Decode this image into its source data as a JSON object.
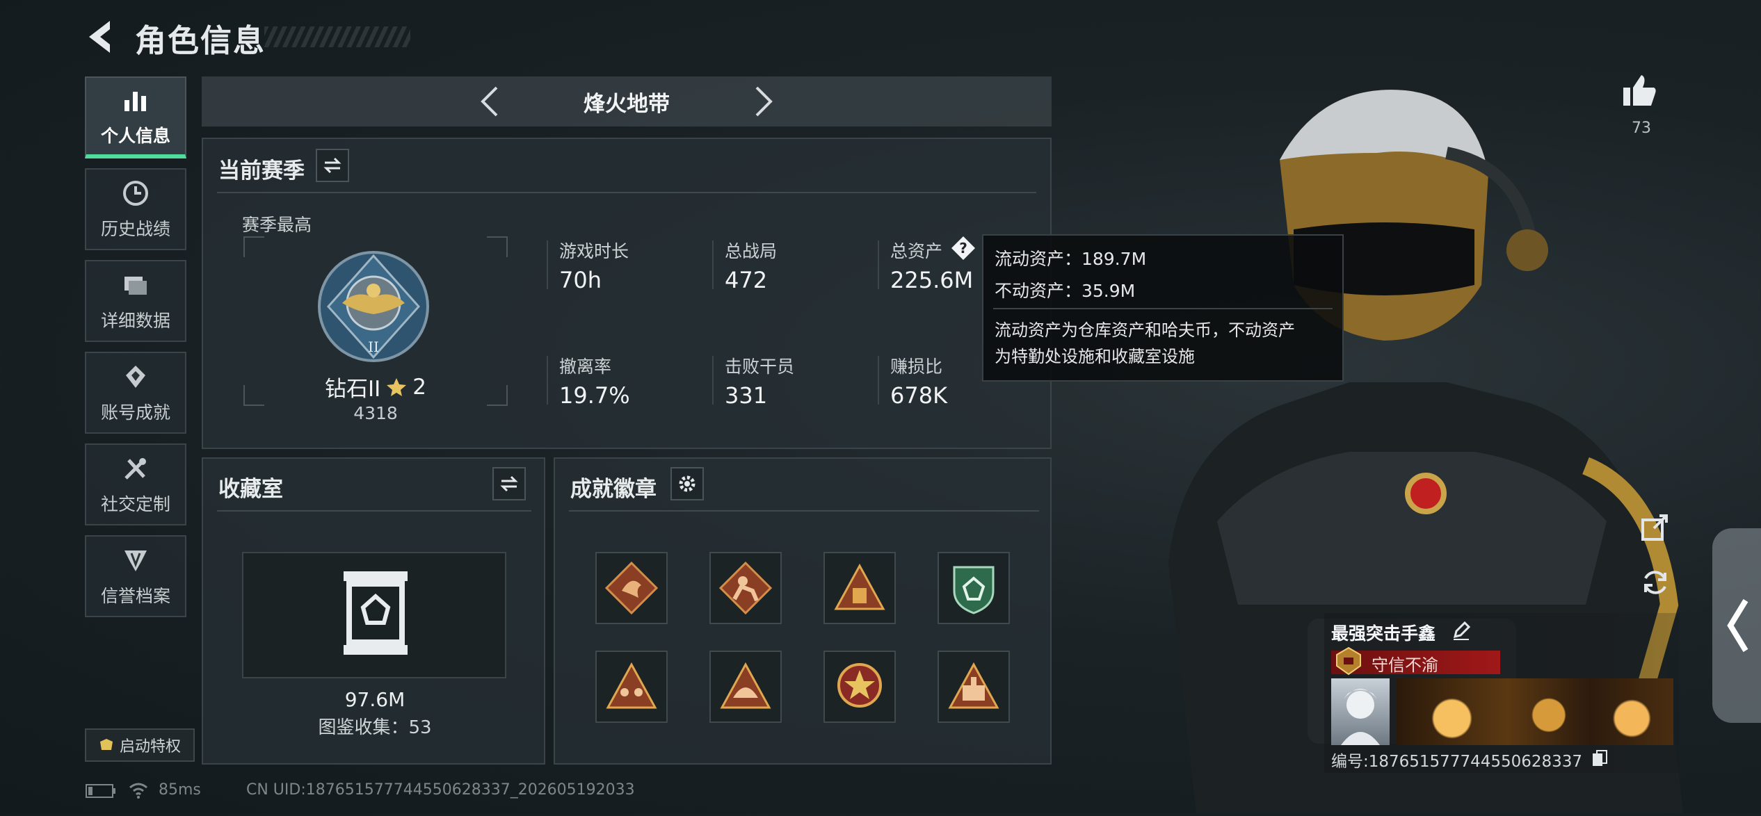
{
  "header": {
    "title": "角色信息"
  },
  "nav": {
    "items": [
      {
        "label": "个人信息",
        "active": true
      },
      {
        "label": "历史战绩"
      },
      {
        "label": "详细数据"
      },
      {
        "label": "账号成就"
      },
      {
        "label": "社交定制"
      },
      {
        "label": "信誉档案"
      }
    ],
    "privilege_label": "启动特权"
  },
  "mode": {
    "name": "烽火地带"
  },
  "season": {
    "title": "当前赛季",
    "best_label": "赛季最高",
    "rank_name": "钻石II",
    "rank_stars": "2",
    "rank_points": "4318",
    "stats": [
      {
        "label": "游戏时长",
        "value": "70h"
      },
      {
        "label": "总战局",
        "value": "472"
      },
      {
        "label": "总资产",
        "value": "225.6M"
      },
      {
        "label": "撤离率",
        "value": "19.7%"
      },
      {
        "label": "击败干员",
        "value": "331"
      },
      {
        "label": "赚损比",
        "value": "678K"
      }
    ]
  },
  "tooltip": {
    "line1": "流动资产：189.7M",
    "line2": "不动资产：35.9M",
    "desc1": "流动资产为仓库资产和哈夫币，不动资产",
    "desc2": "为特勤处设施和收藏室设施"
  },
  "collection": {
    "title": "收藏室",
    "value": "97.6M",
    "catalog": "图鉴收集：53"
  },
  "achievements": {
    "title": "成就徽章"
  },
  "profile": {
    "like_count": "73",
    "name": "最强突击手鑫",
    "honor": "守信不渝",
    "uid": "编号:187651577744550628337"
  },
  "status": {
    "ping": "85ms",
    "uid_text": "CN UID:187651577744550628337_202605192033"
  }
}
